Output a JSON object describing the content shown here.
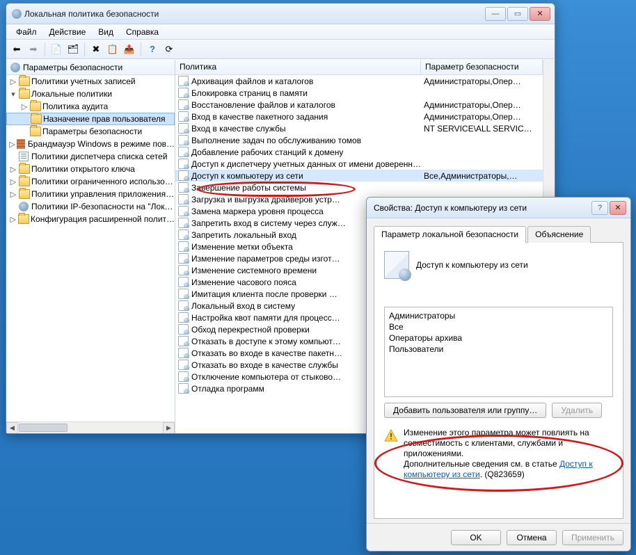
{
  "main": {
    "title": "Локальная политика безопасности",
    "menu": [
      "Файл",
      "Действие",
      "Вид",
      "Справка"
    ],
    "tree_header": "Параметры безопасности",
    "tree": {
      "root": "Параметры безопасности",
      "accounts": "Политики учетных записей",
      "local": "Локальные политики",
      "audit": "Политика аудита",
      "rights": "Назначение прав пользователя",
      "secopts": "Параметры безопасности",
      "firewall": "Брандмауэр Windows в режиме пов…",
      "netlist": "Политики диспетчера списка сетей",
      "pubkey": "Политики открытого ключа",
      "restrict": "Политики ограниченного использо…",
      "appctrl": "Политики управления приложения…",
      "ipsec": "Политики IP-безопасности на \"Лок…",
      "advaudit": "Конфигурация расширенной полит…"
    },
    "columns": {
      "c1": "Политика",
      "c2": "Параметр безопасности"
    },
    "rows": [
      {
        "name": "Архивация файлов и каталогов",
        "val": "Администраторы,Опер…"
      },
      {
        "name": "Блокировка страниц в памяти",
        "val": ""
      },
      {
        "name": "Восстановление файлов и каталогов",
        "val": "Администраторы,Опер…"
      },
      {
        "name": "Вход в качестве пакетного задания",
        "val": "Администраторы,Опер…"
      },
      {
        "name": "Вход в качестве службы",
        "val": "NT SERVICE\\ALL SERVIC…"
      },
      {
        "name": "Выполнение задач по обслуживанию томов",
        "val": ""
      },
      {
        "name": "Добавление рабочих станций к домену",
        "val": ""
      },
      {
        "name": "Доступ к диспетчеру учетных данных от имени доверенн…",
        "val": ""
      },
      {
        "name": "Доступ к компьютеру из сети",
        "val": "Все,Администраторы,…",
        "sel": true
      },
      {
        "name": "Завершение работы системы",
        "val": ""
      },
      {
        "name": "Загрузка и выгрузка драйверов устр…",
        "val": ""
      },
      {
        "name": "Замена маркера уровня процесса",
        "val": ""
      },
      {
        "name": "Запретить вход в систему через служ…",
        "val": ""
      },
      {
        "name": "Запретить локальный вход",
        "val": ""
      },
      {
        "name": "Изменение метки объекта",
        "val": ""
      },
      {
        "name": "Изменение параметров среды изгот…",
        "val": ""
      },
      {
        "name": "Изменение системного времени",
        "val": ""
      },
      {
        "name": "Изменение часового пояса",
        "val": ""
      },
      {
        "name": "Имитация клиента после проверки …",
        "val": ""
      },
      {
        "name": "Локальный вход в систему",
        "val": ""
      },
      {
        "name": "Настройка квот памяти для процесс…",
        "val": ""
      },
      {
        "name": "Обход перекрестной проверки",
        "val": ""
      },
      {
        "name": "Отказать в доступе к этому компьют…",
        "val": ""
      },
      {
        "name": "Отказать во входе в качестве пакетн…",
        "val": ""
      },
      {
        "name": "Отказать во входе в качестве службы",
        "val": ""
      },
      {
        "name": "Отключение компьютера от стыково…",
        "val": ""
      },
      {
        "name": "Отладка программ",
        "val": ""
      }
    ]
  },
  "props": {
    "title": "Свойства: Доступ к компьютеру из сети",
    "tabs": {
      "local": "Параметр локальной безопасности",
      "explain": "Объяснение"
    },
    "policy_name": "Доступ к компьютеру из сети",
    "users": [
      "Администраторы",
      "Все",
      "Операторы архива",
      "Пользователи"
    ],
    "add_btn": "Добавить пользователя или группу…",
    "del_btn": "Удалить",
    "warn_text1": "Изменение этого параметра может повлиять на совместимость с клиентами, службами и приложениями.",
    "warn_text2a": "Дополнительные сведения см. в статье ",
    "warn_link": "Доступ к компьютеру из сети",
    "warn_text2b": ". (Q823659)",
    "ok": "OK",
    "cancel": "Отмена",
    "apply": "Применить"
  }
}
